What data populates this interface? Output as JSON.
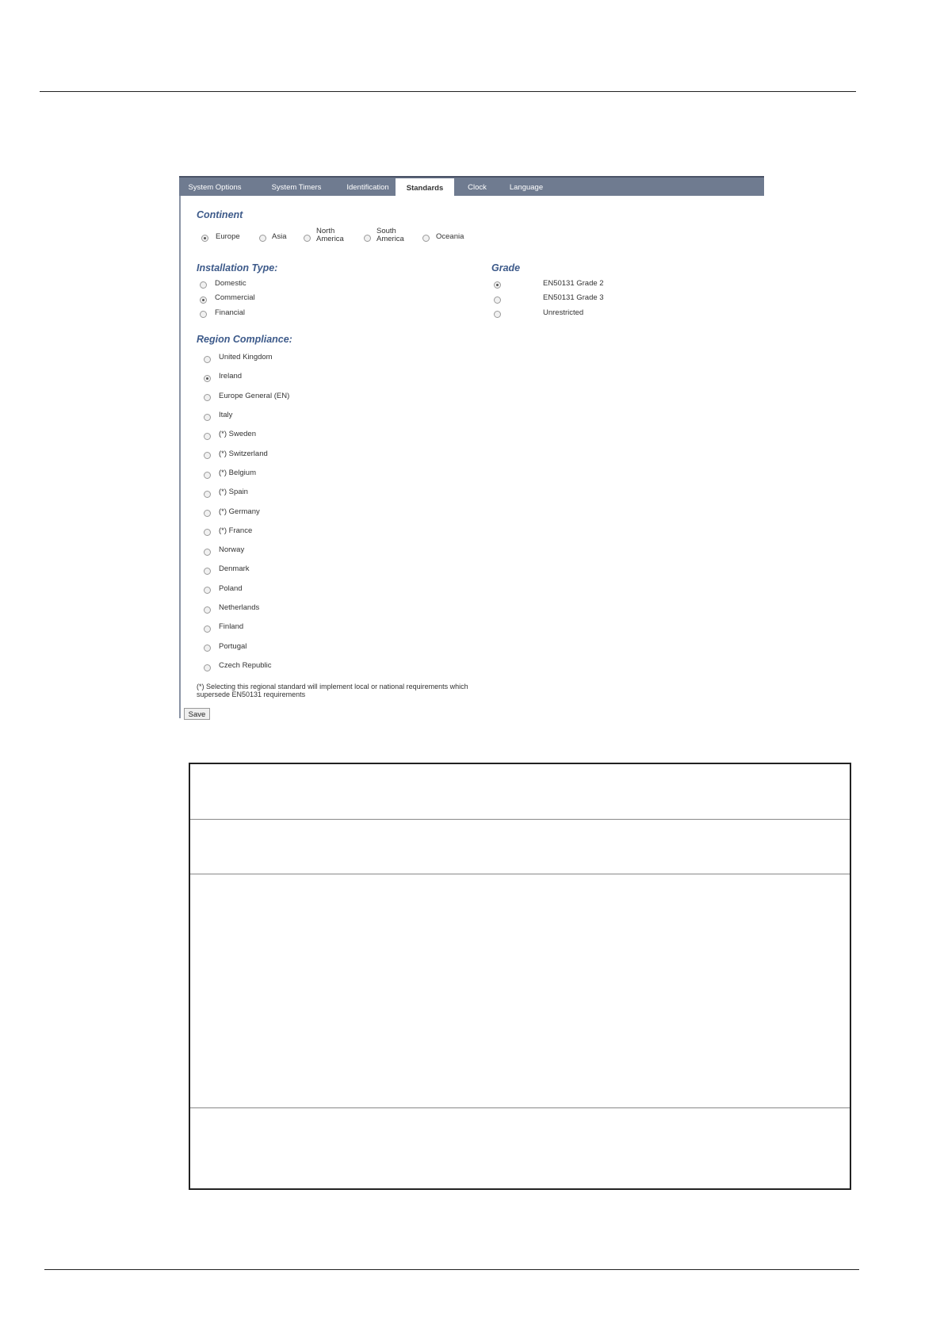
{
  "tabs": [
    {
      "label": "System Options",
      "active": false
    },
    {
      "label": "System Timers",
      "active": false
    },
    {
      "label": "Identification",
      "active": false
    },
    {
      "label": "Standards",
      "active": true
    },
    {
      "label": "Clock",
      "active": false
    },
    {
      "label": "Language",
      "active": false
    }
  ],
  "continent": {
    "title": "Continent",
    "options": [
      {
        "label": "Europe",
        "checked": true
      },
      {
        "label": "Asia",
        "checked": false
      },
      {
        "label": "North America",
        "line1": "North",
        "line2": "America",
        "checked": false
      },
      {
        "label": "South America",
        "line1": "South",
        "line2": "America",
        "checked": false
      },
      {
        "label": "Oceania",
        "checked": false
      }
    ]
  },
  "installation_type": {
    "title": "Installation Type:",
    "options": [
      {
        "label": "Domestic",
        "checked": false
      },
      {
        "label": "Commercial",
        "checked": true
      },
      {
        "label": "Financial",
        "checked": false
      }
    ]
  },
  "grade": {
    "title": "Grade",
    "options": [
      {
        "label": "EN50131 Grade 2",
        "checked": true
      },
      {
        "label": "EN50131 Grade 3",
        "checked": false
      },
      {
        "label": "Unrestricted",
        "checked": false
      }
    ]
  },
  "region": {
    "title": "Region Compliance:",
    "options": [
      {
        "label": "United Kingdom",
        "checked": false
      },
      {
        "label": "Ireland",
        "checked": true
      },
      {
        "label": "Europe General (EN)",
        "checked": false
      },
      {
        "label": "Italy",
        "checked": false
      },
      {
        "label": "(*) Sweden",
        "checked": false
      },
      {
        "label": "(*) Switzerland",
        "checked": false
      },
      {
        "label": "(*) Belgium",
        "checked": false
      },
      {
        "label": "(*) Spain",
        "checked": false
      },
      {
        "label": "(*) Germany",
        "checked": false
      },
      {
        "label": "(*) France",
        "checked": false
      },
      {
        "label": "Norway",
        "checked": false
      },
      {
        "label": "Denmark",
        "checked": false
      },
      {
        "label": "Poland",
        "checked": false
      },
      {
        "label": "Netherlands",
        "checked": false
      },
      {
        "label": "Finland",
        "checked": false
      },
      {
        "label": "Portugal",
        "checked": false
      },
      {
        "label": "Czech Republic",
        "checked": false
      }
    ]
  },
  "footnote": "(*) Selecting this regional standard will implement local or national requirements which supersede EN50131 requirements",
  "save_label": "Save"
}
